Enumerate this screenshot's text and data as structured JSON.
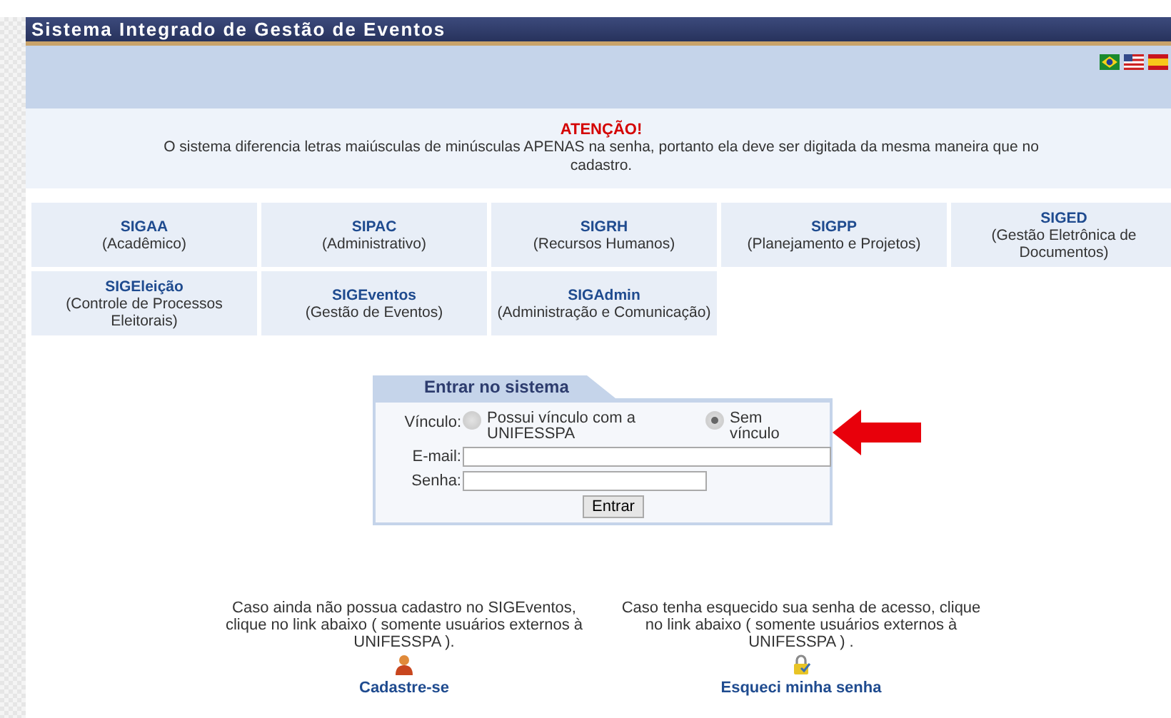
{
  "window": {
    "title": "Sistema Integrado de Gestão de Eventos"
  },
  "notice": {
    "title": "ATENÇÃO!",
    "text": "O sistema diferencia letras maiúsculas de minúsculas APENAS na senha, portanto ela deve ser digitada da mesma maneira que no cadastro."
  },
  "systems": [
    {
      "name": "SIGAA",
      "description": "(Acadêmico)"
    },
    {
      "name": "SIPAC",
      "description": "(Administrativo)"
    },
    {
      "name": "SIGRH",
      "description": "(Recursos Humanos)"
    },
    {
      "name": "SIGPP",
      "description": "(Planejamento e Projetos)"
    },
    {
      "name": "SIGED",
      "description": "(Gestão Eletrônica de Documentos)"
    },
    {
      "name": "SIGEleição",
      "description": "(Controle de Processos Eleitorais)"
    },
    {
      "name": "SIGEventos",
      "description": "(Gestão de Eventos)"
    },
    {
      "name": "SIGAdmin",
      "description": "(Administração e Comunicação)"
    }
  ],
  "login": {
    "title": "Entrar no sistema",
    "vinculo_label": "Vínculo:",
    "options": [
      {
        "label": "Possui vínculo com a UNIFESSPA",
        "selected": false
      },
      {
        "label": "Sem vínculo",
        "selected": true
      }
    ],
    "email_label": "E-mail:",
    "password_label": "Senha:",
    "button": "Entrar"
  },
  "footer": [
    {
      "text": "Caso ainda não possua cadastro no SIGEventos, clique no link abaixo ( somente usuários externos à UNIFESSPA ).",
      "link": "Cadastre-se",
      "kind": "user"
    },
    {
      "text": "Caso tenha esquecido sua senha de acesso, clique no link abaixo ( somente usuários externos à UNIFESSPA ) .",
      "link": "Esqueci minha senha",
      "kind": "lock"
    }
  ]
}
